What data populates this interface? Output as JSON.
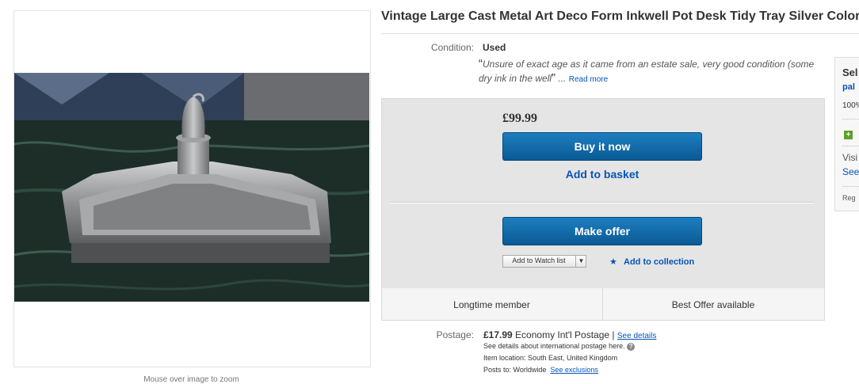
{
  "listing": {
    "title": "Vintage Large Cast Metal Art Deco Form Inkwell Pot Desk Tidy Tray Silver Color",
    "image_hint": "Mouse over image to zoom",
    "condition": {
      "label": "Condition:",
      "value": "Used",
      "open_quote": "“",
      "description": "Unsure of exact age as it came from an estate sale, very good condition (some dry ink in the well",
      "close_quote": "”",
      "ellipsis": " ... ",
      "read_more": "Read more"
    }
  },
  "buy_box": {
    "price": "£99.99",
    "buy_now": "Buy it now",
    "add_to_basket": "Add to basket",
    "make_offer": "Make offer",
    "watch_list": "Add to Watch list",
    "add_to_collection": "Add to collection"
  },
  "badges": [
    "Longtime member",
    "Best Offer available"
  ],
  "postage": {
    "label": "Postage:",
    "price": "£17.99",
    "service": "Economy Int'l Postage |",
    "see_details": "See details",
    "intl_note": "See details about international postage here.",
    "help_icon": "?",
    "item_location": "Item location: South East, United Kingdom",
    "posts_to": "Posts to: Worldwide",
    "see_exclusions": "See exclusions"
  },
  "seller": {
    "title": "Sel",
    "name": "pal",
    "feedback": "100%",
    "plus_icon": "+",
    "visit": "Visi",
    "see": "See",
    "registered": "Reg"
  },
  "colors": {
    "accent_blue": "#0654ba",
    "button_blue": "#0a5a94",
    "box_grey": "#e5e5e5"
  },
  "icons": {
    "star": "star-icon",
    "caret": "chevron-down-icon",
    "help": "help-icon",
    "plus": "plus-icon"
  }
}
